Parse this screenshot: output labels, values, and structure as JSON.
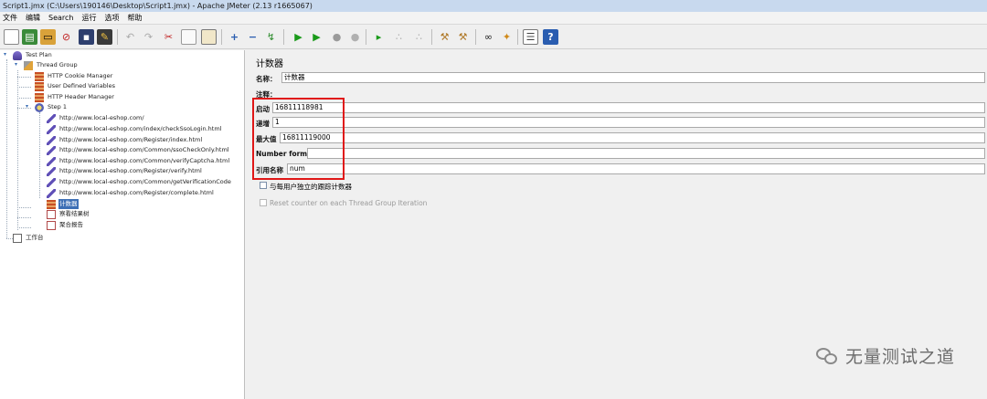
{
  "window": {
    "title": "Script1.jmx (C:\\Users\\190146\\Desktop\\Script1.jmx) - Apache JMeter (2.13 r1665067)"
  },
  "menu": [
    "文件",
    "编辑",
    "Search",
    "运行",
    "选项",
    "帮助"
  ],
  "toolbar": {
    "icons": [
      "new-icon",
      "templates-icon",
      "open-icon",
      "close-icon",
      "save-icon",
      "save-as-icon",
      "cut-icon",
      "copy-icon",
      "paste-icon",
      "expand-icon",
      "collapse-icon",
      "toggle-icon",
      "start-icon",
      "start-no-timers-icon",
      "stop-icon",
      "shutdown-icon",
      "remote-start-icon",
      "remote-stop-icon",
      "remote-shutdown-icon",
      "clear-icon",
      "clear-all-icon",
      "search-icon",
      "reset-search-icon",
      "function-helper-icon",
      "help-icon"
    ]
  },
  "tree": {
    "test_plan": "Test Plan",
    "thread_group": "Thread Group",
    "configs": [
      "HTTP Cookie Manager",
      "User Defined Variables",
      "HTTP Header Manager"
    ],
    "step": "Step 1",
    "requests": [
      "http://www.local-eshop.com/",
      "http://www.local-eshop.com/index/checkSsoLogin.html",
      "http://www.local-eshop.com/Register/index.html",
      "http://www.local-eshop.com/Common/ssoCheckOnly.html",
      "http://www.local-eshop.com/Common/verifyCaptcha.html",
      "http://www.local-eshop.com/Register/verify.html",
      "http://www.local-eshop.com/Common/getVerificationCode",
      "http://www.local-eshop.com/Register/complete.html"
    ],
    "counter": "计数器",
    "listeners": [
      "察看结果树",
      "聚合报告"
    ],
    "workbench": "工作台"
  },
  "counter_panel": {
    "title": "计数器",
    "name_label": "名称：",
    "name_value": "计数器",
    "comment_label": "注释：",
    "start_label": "启动",
    "start_value": "16811118981",
    "increment_label": "递增",
    "increment_value": "1",
    "max_label": "最大值",
    "max_value": "16811119000",
    "format_label": "Number format",
    "format_value": "",
    "refname_label": "引用名称",
    "refname_value": "num",
    "per_user_label": "与每用户独立的跟踪计数器",
    "per_user_checked": false,
    "reset_label": "Reset counter on each Thread Group Iteration",
    "reset_checked": false
  },
  "watermark": {
    "text": "无量测试之道"
  },
  "colors": {
    "highlight": "#e01818",
    "selection": "#3d6fb5"
  }
}
